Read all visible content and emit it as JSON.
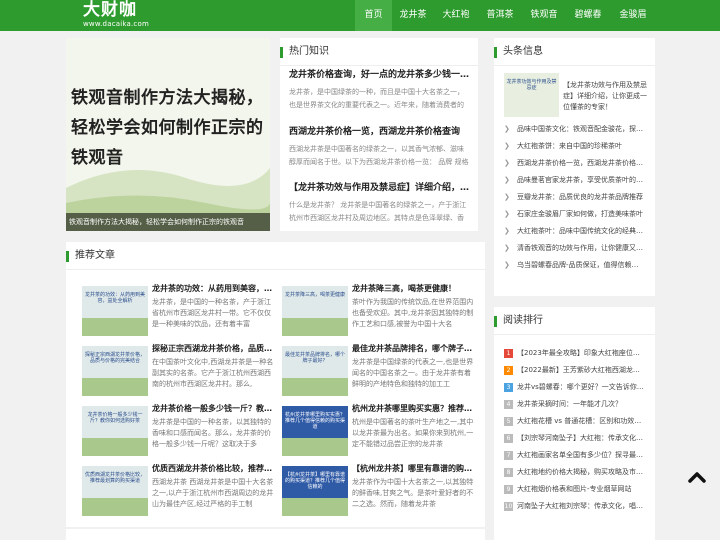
{
  "header": {
    "logo_main": "大财咖",
    "logo_sub": "www.dacaika.com",
    "nav": [
      "首页",
      "龙井茶",
      "大红袍",
      "普洱茶",
      "铁观音",
      "碧螺春",
      "金骏眉"
    ]
  },
  "slider": {
    "headline": "铁观音制作方法大揭秘，轻松学会如何制作正宗的铁观音",
    "caption": "铁观音制作方法大揭秘，轻松学会如何制作正宗的铁观音"
  },
  "hot": {
    "heading": "热门知识",
    "items": [
      {
        "title": "龙井茶价格查询，好一点的龙井茶多少钱一斤？",
        "summary": "龙井茶，是中国绿茶的一种，而且是中国十大名茶之一，也是世界茶文化的重要代表之一。近年来，随着消费者的日益"
      },
      {
        "title": "西湖龙井茶价格一览，西湖龙井茶价格查询",
        "summary": "西湖龙井茶是中国著名的绿茶之一，以其香气浓郁、滋味醇厚而闻名于世。以下为西湖龙井茶价格一览： 品牌 规格 价格 西"
      },
      {
        "title": "【龙井茶功效与作用及禁忌症】详细介绍，让你更了解",
        "summary": "什么是龙井茶？ 龙井茶是中国著名的绿茶之一，产于浙江杭州市西湖区龙井村及周边地区。其特点是色泽翠绿、香气高"
      }
    ]
  },
  "recommend": {
    "heading": "推荐文章",
    "items": [
      {
        "thumb": "龙井茶的功效：从药用到美容，益处全解析",
        "title": "龙井茶的功效：从药用到美容，益处全解析",
        "summary": "龙井茶，是中国的一种名茶，产于浙江省杭州市西湖区龙井村一带。它不仅仅是一种美味的饮品，还有着丰富"
      },
      {
        "thumb": "龙井茶降三高，喝茶更健康",
        "title": "龙井茶降三高，喝茶更健康！",
        "summary": "茶叶作为我国的传统饮品,在世界范围内也备受欢迎。其中,龙井茶因其独特的制作工艺和口感,被誉为中国十大名"
      },
      {
        "thumb": "探秘正宗西湖龙井茶价格，品质与价格的完美结合",
        "title": "探秘正宗西湖龙井茶价格，品质与价格的完美结合",
        "summary": "在中国茶叶文化中,西湖龙井茶是一种名副其实的名茶。它产于浙江杭州西湖西南的杭州市西湖区龙井村。那么,"
      },
      {
        "thumb": "最佳龙井茶品牌排名，哪个牌子最好？",
        "title": "最佳龙井茶品牌排名，哪个牌子最好？",
        "summary": "龙井茶是中国绿茶的代表之一,也是世界闻名的中国名茶之一。由于龙井茶有着鲜明的产地特色和独特的加工工"
      },
      {
        "thumb": "龙井茶价格一般多少钱一斤？教你如何选购好茶",
        "title": "龙井茶价格一般多少钱一斤？教你如何选购好茶",
        "summary": "龙井茶是中国的一种名茶，以其独特的香味和口感而闻名。那么，龙井茶的价格一般多少钱一斤呢？这取决于多"
      },
      {
        "thumb": "杭州龙井茶哪里购买实惠？推荐几个值得信赖的购买渠道",
        "title": "杭州龙井茶哪里购买实惠？推荐几个值得信赖的购买渠道",
        "summary": "杭州是中国著名的茶叶生产地之一,其中以龙井茶最为出名。如果你来到杭州,一定不能错过品尝正宗的龙井茶"
      },
      {
        "thumb": "优质西湖龙井茶价格比较，推荐最划算的购买渠道",
        "title": "优质西湖龙井茶价格比较，推荐最划算的购买渠道",
        "summary": "西湖龙井茶 西湖龙井茶是中国十大名茶之一,以产于浙江杭州市西湖周边的龙井山为最佳产区,经过严格的手工制"
      },
      {
        "thumb": "【杭州龙井茶】哪里有靠谱的购买渠道？推荐几个值得信赖的",
        "title": "【杭州龙井茶】哪里有靠谱的购买渠道？推荐几个值得信赖的",
        "summary": "龙井茶作为中国十大名茶之一,以其独特的鲜香味,甘爽之气。是茶叶爱好者的不二之选。然而，随着龙井茶"
      }
    ]
  },
  "headlines": {
    "heading": "头条信息",
    "feature_thumb": "龙井茶功效与作用及禁忌症",
    "feature_title": "【龙井茶功效与作用及禁忌症】详细介绍，让你更成一位懂茶的专家！",
    "items": [
      "品味中国茶文化：铁观音配金骏花，探索多元茶香",
      "大红袍茶饼：来自中国的珍稀茶叶",
      "西湖龙井茶价格一览，西湖龙井茶价格查询",
      "品味曼茗官家龙井茶，享受优质茶叶的美好时光",
      "豆瓣龙井茶：品质优良的龙井茶品牌推荐",
      "石家庄金骏眉厂家如何做，打造美味茶叶",
      "大红袍茶叶：品味中国传统文化的经典之选",
      "清香铁观音的功效与作用，让你健康又美丽",
      "乌当碧螺春品牌-品质保证，值得信赖的选择"
    ]
  },
  "ranking": {
    "heading": "阅读排行",
    "items": [
      "【2023年最全攻略】印象大红袍座位图，选座指南",
      "【2022最新】王芳紫砂大红袍西湖龙井茶价格",
      "龙井vs碧螺春：哪个更好？一文告诉你答案",
      "龙井茶采摘时间：一年能才几次？",
      "大红袍花槽 vs 普通花槽：区别和功效详解",
      "【刘宗琴河南坠子】大红袍：传承文化，唱响中华",
      "大红袍画家名单全国有多少位？探寻最受欢迎的大红袍",
      "大红袍地约价格大揭秘，购买攻略及市场行情",
      "大红袍烟价格表和图片-专业烟草网站",
      "河南坠子大红袍刘宗琴：传承文化，唱响中华"
    ]
  },
  "colors": {
    "brand": "#2e9b2e",
    "nav_active": "#45ae45",
    "rank_top": [
      "#e5493a",
      "#ff8a00",
      "#4ba3e1"
    ]
  }
}
